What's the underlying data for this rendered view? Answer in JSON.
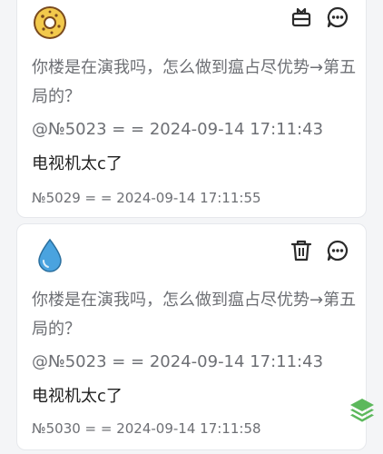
{
  "posts": [
    {
      "avatar_icon": "donut-icon",
      "actions": [
        "gift-icon",
        "comment-icon"
      ],
      "quote_text": "你楼是在演我吗，怎么做到瘟占尽优势→第五局的？",
      "quote_meta": "@№5023 = = 2024-09-14 17:11:43",
      "reply_text": "电视机太c了",
      "post_meta": "№5029 = = 2024-09-14 17:11:55"
    },
    {
      "avatar_icon": "water-drop-icon",
      "actions": [
        "delete-icon",
        "comment-icon"
      ],
      "quote_text": "你楼是在演我吗，怎么做到瘟占尽优势→第五局的？",
      "quote_meta": "@№5023 = = 2024-09-14 17:11:43",
      "reply_text": "电视机太c了",
      "post_meta": "№5030 = = 2024-09-14 17:11:58"
    }
  ],
  "fab_icon": "layers-icon",
  "colors": {
    "icon_dark": "#2b2b2b",
    "accent_green": "#5cb85c",
    "drop_blue": "#4aa3df",
    "donut_yellow": "#f2c94c",
    "donut_brown": "#7a4a1e"
  }
}
